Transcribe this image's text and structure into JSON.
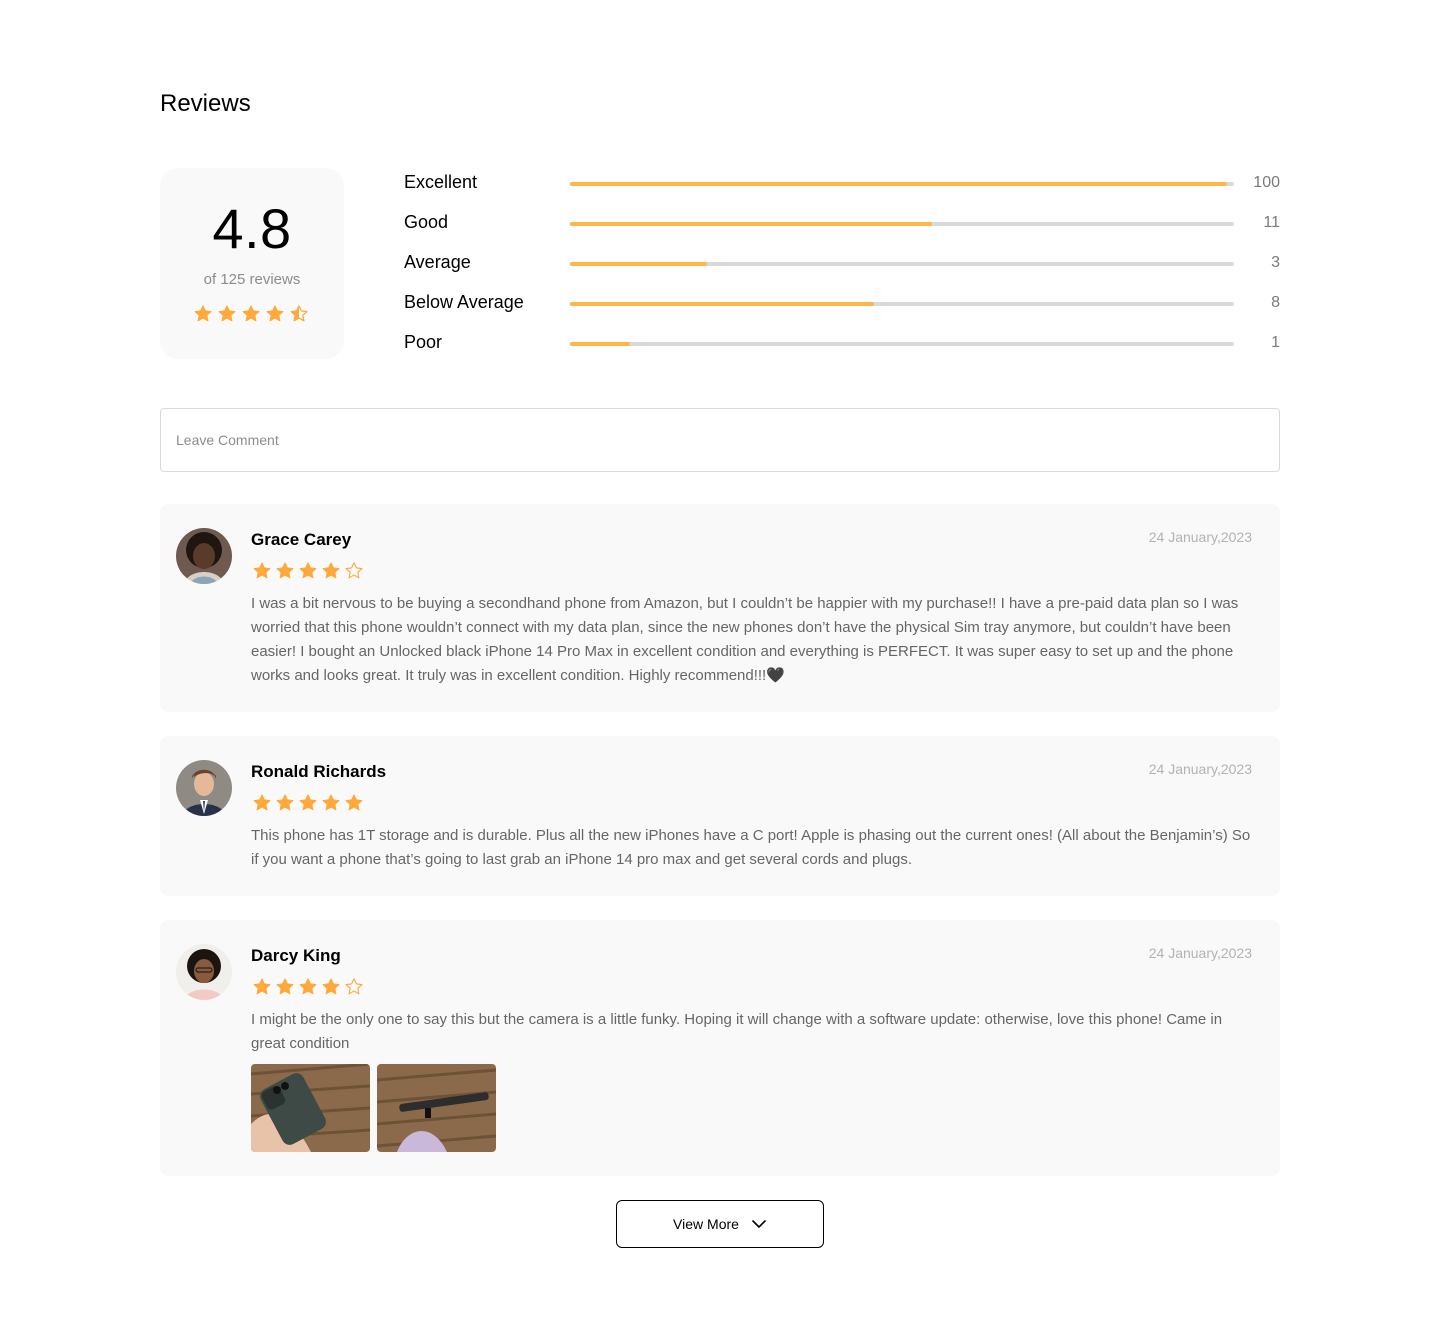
{
  "page": {
    "title": "Reviews"
  },
  "summary": {
    "score": "4.8",
    "count_text": "of 125 reviews",
    "stars": [
      "full",
      "full",
      "full",
      "full",
      "half"
    ]
  },
  "breakdown": [
    {
      "label": "Excellent",
      "value": "100",
      "fill_fraction": 0.99
    },
    {
      "label": "Good",
      "value": "11",
      "fill_fraction": 0.545
    },
    {
      "label": "Average",
      "value": "3",
      "fill_fraction": 0.207
    },
    {
      "label": "Below Average",
      "value": "8",
      "fill_fraction": 0.458
    },
    {
      "label": "Poor",
      "value": "1",
      "fill_fraction": 0.09
    }
  ],
  "comment": {
    "placeholder": "Leave Comment"
  },
  "reviews": [
    {
      "name": "Grace Carey",
      "date": "24 January,2023",
      "rating": 4,
      "text": "I was a bit nervous to be buying a secondhand phone from Amazon, but I couldn’t be happier with my purchase!! I have a pre-paid data plan so I was worried that this phone wouldn’t connect with my data plan, since the new phones don’t have the physical Sim tray anymore, but couldn’t have been easier! I bought an Unlocked black iPhone 14 Pro Max in excellent condition and everything is PERFECT. It was super easy to set up and the phone works and looks great. It truly was in excellent condition. Highly recommend!!!🖤"
    },
    {
      "name": "Ronald Richards",
      "date": "24 January,2023",
      "rating": 5,
      "text": "This phone has 1T storage and is durable. Plus all the new iPhones have a C port! Apple is phasing out the current ones! (All about the Benjamin’s) So if you want a phone that’s going to last grab an iPhone 14 pro max and get several cords and plugs."
    },
    {
      "name": "Darcy King",
      "date": "24 January,2023",
      "rating": 4,
      "text": "I might be the only one to say this but the camera is a little funky. Hoping it will change with a software update: otherwise, love this phone! Came in great condition"
    }
  ],
  "view_more": {
    "label": "View More"
  },
  "colors": {
    "star": "#ffa93a",
    "bar_fill": "#ffb547",
    "bar_track": "#d9d9d9",
    "card_bg": "#f9f9f9"
  }
}
